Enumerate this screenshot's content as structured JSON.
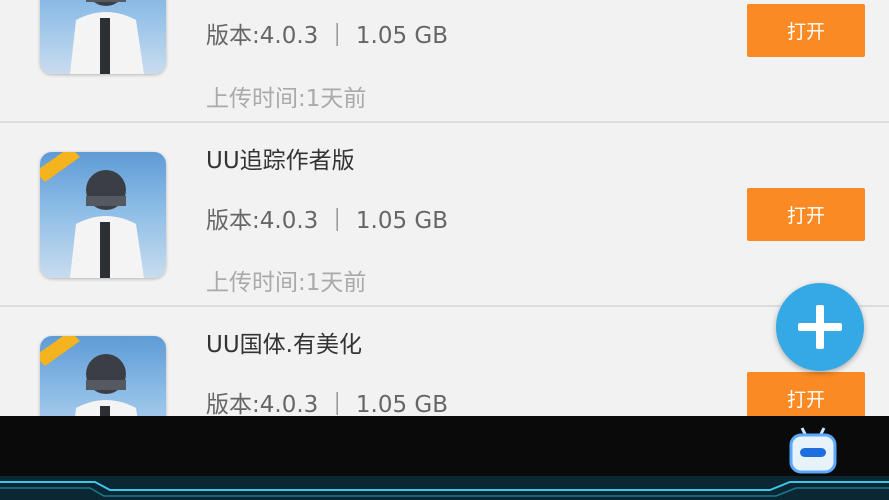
{
  "items": [
    {
      "title": "",
      "version": "版本:4.0.3 ｜ 1.05 GB",
      "upload_time": "上传时间:1天前",
      "open_label": "打开"
    },
    {
      "title": "UU追踪作者版",
      "version": "版本:4.0.3 ｜ 1.05 GB",
      "upload_time": "上传时间:1天前",
      "open_label": "打开"
    },
    {
      "title": "UU国体.有美化",
      "version": "版本:4.0.3 ｜ 1.05 GB",
      "upload_time": "",
      "open_label": "打开"
    }
  ],
  "icons": {
    "app_icon": "game-soldier-icon",
    "fab": "plus-icon",
    "bot": "robot-tv-icon"
  },
  "colors": {
    "button": "#f98a24",
    "fab": "#35a9e6",
    "background": "#f2f2f2"
  }
}
